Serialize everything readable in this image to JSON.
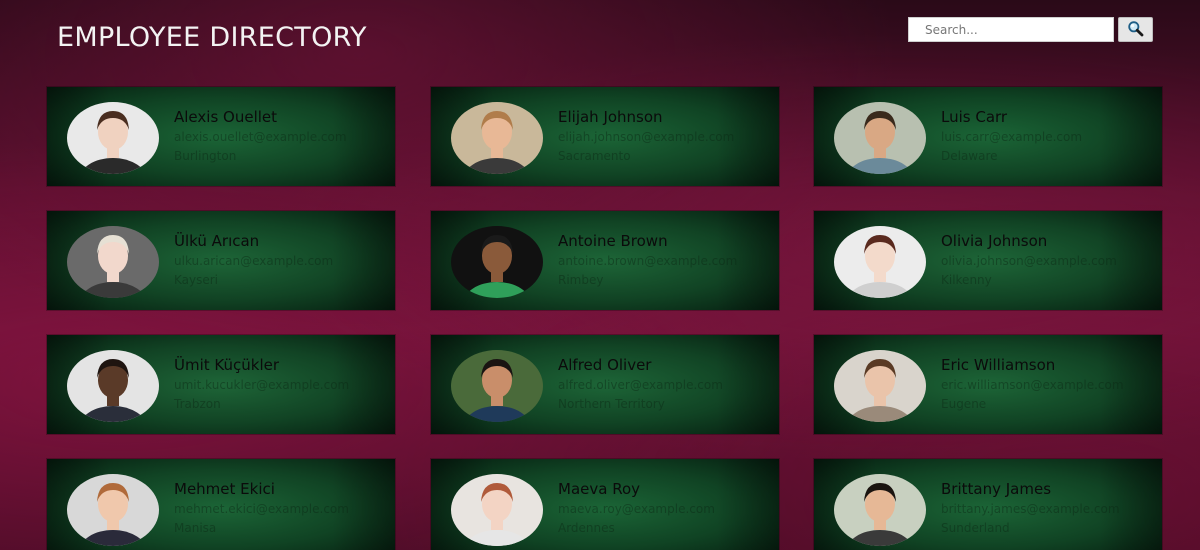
{
  "header": {
    "title": "EMPLOYEE DIRECTORY",
    "search_placeholder": "Search...",
    "search_icon": "search-icon"
  },
  "employees": [
    {
      "name": "Alexis Ouellet",
      "email": "alexis.ouellet@example.com",
      "location": "Burlington",
      "skin": "#f0d2c0",
      "hair": "#4a2e20",
      "shirt": "#2a2a2a",
      "bg": "#e9e9e9"
    },
    {
      "name": "Elijah Johnson",
      "email": "elijah.johnson@example.com",
      "location": "Sacramento",
      "skin": "#e8b896",
      "hair": "#b07c4a",
      "shirt": "#3a3a3a",
      "bg": "#c9b89a"
    },
    {
      "name": "Luis Carr",
      "email": "luis.carr@example.com",
      "location": "Delaware",
      "skin": "#d9a884",
      "hair": "#3a2a1c",
      "shirt": "#6b8a9a",
      "bg": "#b8c0b0"
    },
    {
      "name": "Ülkü Arıcan",
      "email": "ulku.arican@example.com",
      "location": "Kayseri",
      "skin": "#f2d8cc",
      "hair": "#e6e0d4",
      "shirt": "#3a3a3a",
      "bg": "#6a6a6a"
    },
    {
      "name": "Antoine Brown",
      "email": "antoine.brown@example.com",
      "location": "Rimbey",
      "skin": "#8a5a3a",
      "hair": "#1a1a1a",
      "shirt": "#2fa05a",
      "bg": "#111111"
    },
    {
      "name": "Olivia Johnson",
      "email": "olivia.johnson@example.com",
      "location": "Kilkenny",
      "skin": "#f3dacb",
      "hair": "#5a2a1e",
      "shirt": "#cfcfcf",
      "bg": "#ececec"
    },
    {
      "name": "Ümit Küçükler",
      "email": "umit.kucukler@example.com",
      "location": "Trabzon",
      "skin": "#5a3a28",
      "hair": "#1e1410",
      "shirt": "#2a2e3a",
      "bg": "#e4e4e4"
    },
    {
      "name": "Alfred Oliver",
      "email": "alfred.oliver@example.com",
      "location": "Northern Territory",
      "skin": "#c98e6a",
      "hair": "#1a1412",
      "shirt": "#1f3a5a",
      "bg": "#4a6a3a"
    },
    {
      "name": "Eric Williamson",
      "email": "eric.williamson@example.com",
      "location": "Eugene",
      "skin": "#eac4aa",
      "hair": "#5a3a24",
      "shirt": "#9a8a7a",
      "bg": "#d9d4cc"
    },
    {
      "name": "Mehmet Ekici",
      "email": "mehmet.ekici@example.com",
      "location": "Manisa",
      "skin": "#f0c8ac",
      "hair": "#b06a3a",
      "shirt": "#2a2a3a",
      "bg": "#d8d8d8"
    },
    {
      "name": "Maeva Roy",
      "email": "maeva.roy@example.com",
      "location": "Ardennes",
      "skin": "#f3d4c4",
      "hair": "#b05a3a",
      "shirt": "#e6e6e6",
      "bg": "#e8e4e0"
    },
    {
      "name": "Brittany James",
      "email": "brittany.james@example.com",
      "location": "Sunderland",
      "skin": "#e6b896",
      "hair": "#1a1410",
      "shirt": "#3a3a3a",
      "bg": "#c8d0c0"
    }
  ]
}
